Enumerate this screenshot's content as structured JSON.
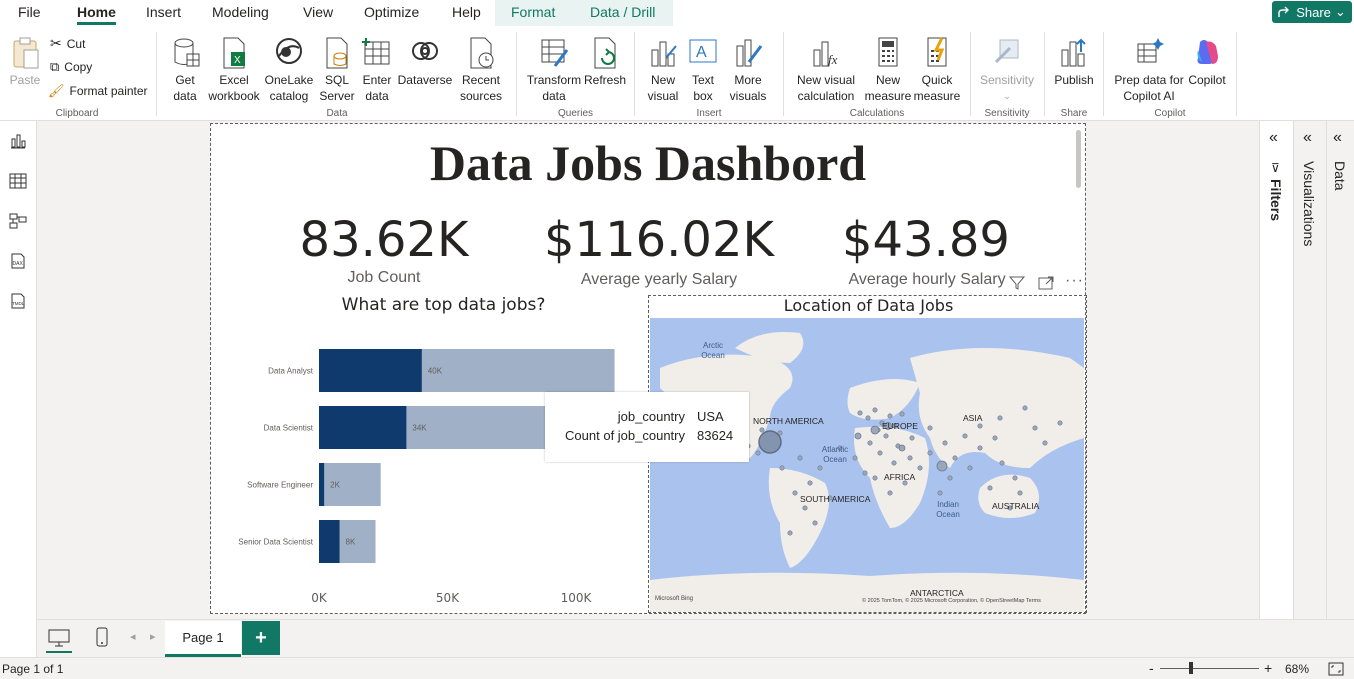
{
  "menu": {
    "items": [
      "File",
      "Home",
      "Insert",
      "Modeling",
      "View",
      "Optimize",
      "Help",
      "Format",
      "Data / Drill"
    ],
    "share": "Share"
  },
  "ribbon": {
    "clipboard": {
      "paste": "Paste",
      "cut": "Cut",
      "copy": "Copy",
      "format_painter": "Format painter",
      "label": "Clipboard"
    },
    "data": {
      "get_data": "Get data",
      "excel": "Excel workbook",
      "onelake": "OneLake catalog",
      "sql": "SQL Server",
      "enter": "Enter data",
      "dataverse": "Dataverse",
      "recent": "Recent sources",
      "label": "Data"
    },
    "queries": {
      "transform": "Transform data",
      "refresh": "Refresh",
      "label": "Queries"
    },
    "insert": {
      "new_visual": "New visual",
      "text_box": "Text box",
      "more_visuals": "More visuals",
      "label": "Insert"
    },
    "calculations": {
      "new_visual_calc": "New visual calculation",
      "new_measure": "New measure",
      "quick_measure": "Quick measure",
      "label": "Calculations"
    },
    "sensitivity": {
      "btn": "Sensitivity",
      "label": "Sensitivity"
    },
    "share": {
      "publish": "Publish",
      "label": "Share"
    },
    "copilot": {
      "prep": "Prep data for Copilot AI",
      "copilot": "Copilot",
      "label": "Copilot"
    }
  },
  "report": {
    "title": "Data Jobs Dashbord",
    "kpis": [
      {
        "value": "83.62K",
        "label": "Job Count"
      },
      {
        "value": "$116.02K",
        "label": "Average yearly Salary"
      },
      {
        "value": "$43.89",
        "label": "Average hourly Salary"
      }
    ],
    "bar_title": "What are top data jobs?",
    "map_title": "Location of Data Jobs",
    "map_labels": {
      "arctic": "Arctic Ocean",
      "north_america": "NORTH AMERICA",
      "europe": "EUROPE",
      "asia": "ASIA",
      "atlantic": "Atlantic Ocean",
      "africa": "AFRICA",
      "south_america": "SOUTH AMERICA",
      "indian": "Indian Ocean",
      "australia": "AUSTRALIA",
      "antarctica": "ANTARCTICA",
      "bing": "Microsoft Bing",
      "copyright": "© 2025 TomTom, © 2025 Microsoft Corporation, © OpenStreetMap  Terms"
    },
    "tooltip": [
      {
        "key": "job_country",
        "value": "USA"
      },
      {
        "key": "Count of job_country",
        "value": "83624"
      }
    ]
  },
  "chart_data": {
    "type": "bar",
    "orientation": "horizontal",
    "title": "What are top data jobs?",
    "categories": [
      "Data Analyst",
      "Data Scientist",
      "Software Engineer",
      "Senior Data Scientist"
    ],
    "series": [
      {
        "values": [
          40,
          34,
          2,
          8
        ],
        "labels": [
          "40K",
          "34K",
          "2K",
          "8K"
        ],
        "color": "#0f3a6d"
      },
      {
        "values": [
          115,
          89,
          24,
          22
        ],
        "color": "#a0b1c7"
      }
    ],
    "x_ticks": [
      "0K",
      "50K",
      "100K"
    ],
    "xlim": [
      0,
      120
    ]
  },
  "pages": {
    "tab": "Page 1"
  },
  "panes": {
    "filters": "Filters",
    "visualizations": "Visualizations",
    "data": "Data"
  },
  "status": {
    "page": "Page 1 of 1",
    "zoom": "68%"
  }
}
